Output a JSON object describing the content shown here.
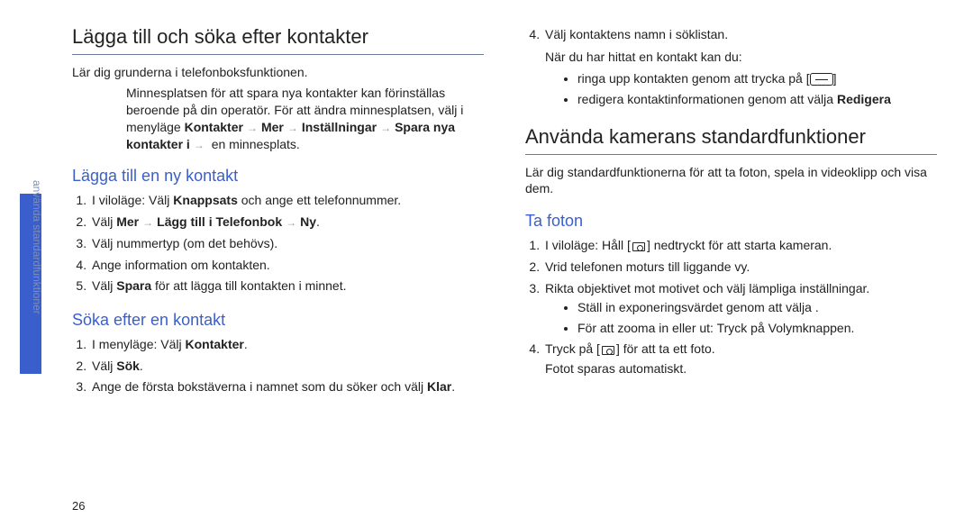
{
  "sideTab": "använda standardfunktioner",
  "pageNumber": "26",
  "left": {
    "h1": "Lägga till och söka efter kontakter",
    "intro": "Lär dig grunderna i telefonboksfunktionen.",
    "note_pt1": "Minnesplatsen för att spara nya kontakter kan förinställas beroende på din operatör. För att ändra minnesplatsen, välj i menyläge ",
    "note_b1": "Kontakter",
    "note_b2": "Mer",
    "note_b3": "Inställningar",
    "note_b4": "Spara nya kontakter i",
    "note_pt2": " en minnesplats.",
    "h2a": "Lägga till en ny kontakt",
    "add1_a": "I viloläge: Välj ",
    "add1_b": "Knappsats",
    "add1_c": " och ange ett telefonnummer.",
    "add2_a": "Välj ",
    "add2_b": "Mer",
    "add2_c": "Lägg till i Telefonbok",
    "add2_d": "Ny",
    "add3": "Välj nummertyp (om det behövs).",
    "add4": "Ange information om kontakten.",
    "add5_a": "Välj ",
    "add5_b": "Spara",
    "add5_c": " för att lägga till kontakten i minnet.",
    "h2b": "Söka efter en kontakt",
    "srch1_a": "I menyläge: Välj ",
    "srch1_b": "Kontakter",
    "srch2_a": "Välj ",
    "srch2_b": "Sök",
    "srch3_a": "Ange de första bokstäverna i namnet som du söker och välj ",
    "srch3_b": "Klar"
  },
  "right": {
    "cont4": "Välj kontaktens namn i söklistan.",
    "found": "När du har hittat en kontakt kan du:",
    "bul1": "ringa upp kontakten genom att trycka på ",
    "bul2_a": "redigera kontaktinformationen genom att välja ",
    "bul2_b": "Redigera",
    "h1": "Använda kamerans standardfunktioner",
    "intro": "Lär dig standardfunktionerna för att ta foton, spela in videoklipp och visa dem.",
    "h2": "Ta foton",
    "p1_a": "I viloläge: Håll [",
    "p1_b": "] nedtryckt för att starta kameran.",
    "p2": "Vrid telefonen moturs till liggande vy.",
    "p3": "Rikta objektivet mot motivet och välj lämpliga inställningar.",
    "p3b1": "Ställ in exponeringsvärdet genom att välja ",
    "p3b2": "För att zooma in eller ut: Tryck på Volymknappen.",
    "p4_a": "Tryck på [",
    "p4_b": "] för att ta ett foto.",
    "p4_c": "Fotot sparas automatiskt."
  }
}
